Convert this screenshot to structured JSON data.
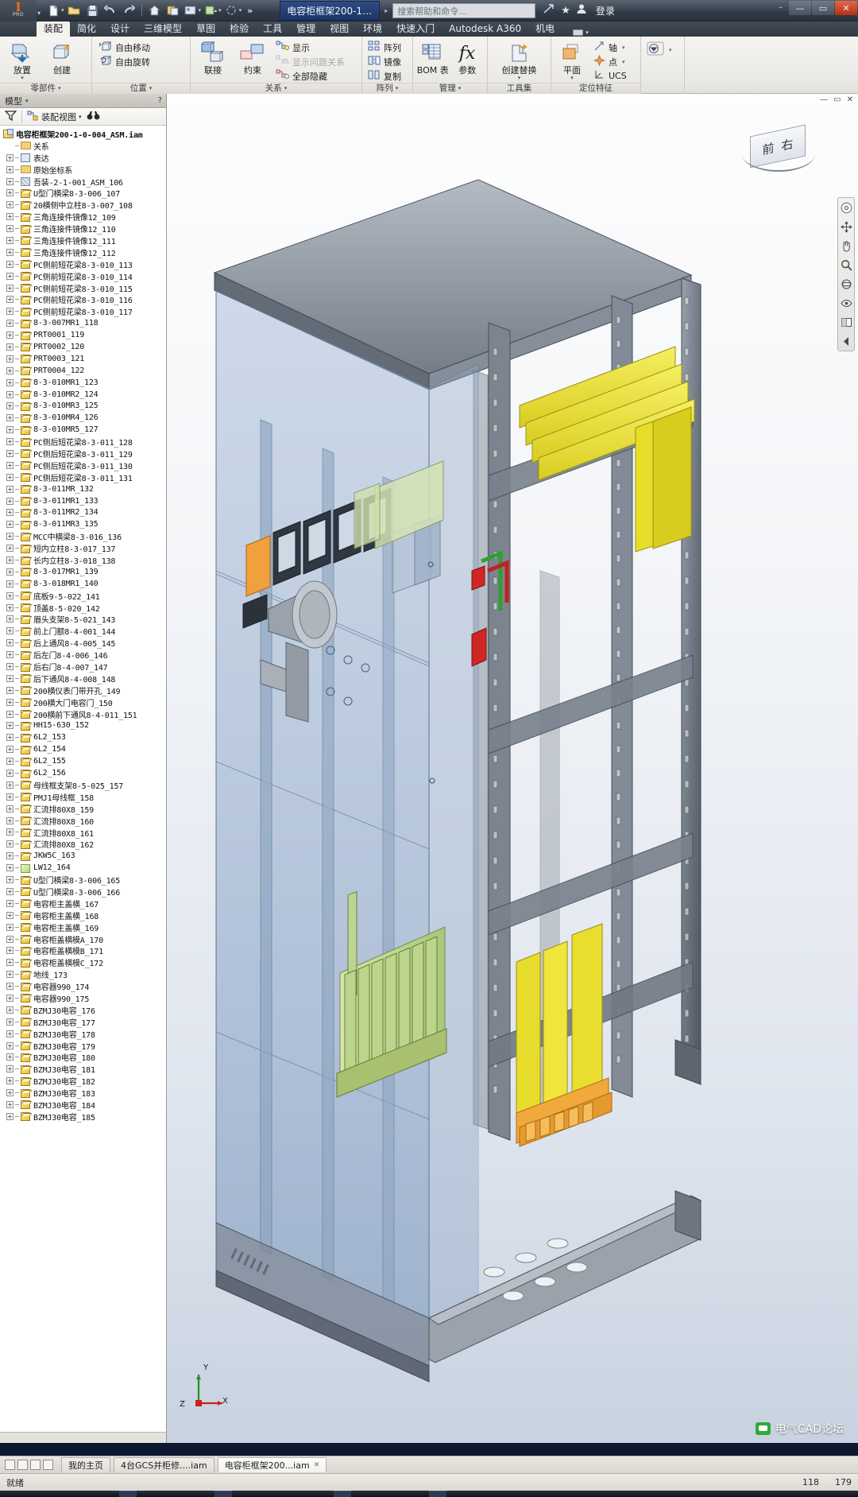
{
  "app": {
    "product": "Autodesk Inventor Professional",
    "logo_mark": "I",
    "logo_sub": "PRO",
    "document_title": "电容柜框架200-1-...",
    "search_placeholder": "搜索帮助和命令...",
    "sign_in": "登录",
    "window_buttons": {
      "minimize": "—",
      "maximize": "▭",
      "close": "✕"
    },
    "quick_access": [
      {
        "name": "new-file-icon",
        "glyph": "📄"
      },
      {
        "name": "open-file-icon",
        "glyph": "📂"
      },
      {
        "name": "save-icon",
        "glyph": "💾"
      },
      {
        "name": "undo-icon",
        "glyph": "↩"
      },
      {
        "name": "redo-icon",
        "glyph": "↪"
      },
      {
        "name": "home-icon",
        "glyph": "⌂"
      },
      {
        "name": "project-icon",
        "glyph": "🗂"
      },
      {
        "name": "appearance-icon",
        "glyph": "🎨"
      },
      {
        "name": "update-icon",
        "glyph": "🔄"
      },
      {
        "name": "select-icon",
        "glyph": "⬚"
      },
      {
        "name": "more-icon",
        "glyph": "»"
      }
    ],
    "title_icons": [
      {
        "name": "share-icon",
        "glyph": "⎋"
      },
      {
        "name": "favorites-icon",
        "glyph": "★"
      },
      {
        "name": "user-icon",
        "glyph": "👤"
      }
    ]
  },
  "ribbon": {
    "tabs": [
      {
        "label": "装配",
        "active": true
      },
      {
        "label": "简化",
        "active": false
      },
      {
        "label": "设计",
        "active": false
      },
      {
        "label": "三维模型",
        "active": false
      },
      {
        "label": "草图",
        "active": false
      },
      {
        "label": "检验",
        "active": false
      },
      {
        "label": "工具",
        "active": false
      },
      {
        "label": "管理",
        "active": false
      },
      {
        "label": "视图",
        "active": false
      },
      {
        "label": "环境",
        "active": false
      },
      {
        "label": "快速入门",
        "active": false
      },
      {
        "label": "Autodesk A360",
        "active": false
      },
      {
        "label": "机电",
        "active": false
      }
    ],
    "panels": [
      {
        "label": "零部件",
        "has_caret": true,
        "big_buttons": [
          {
            "label": "放置",
            "icon": "place-component-icon",
            "dropdown": true
          },
          {
            "label": "创建",
            "icon": "create-component-icon",
            "dropdown": false
          }
        ],
        "small_buttons": []
      },
      {
        "label": "位置",
        "has_caret": true,
        "big_buttons": [],
        "small_buttons": [
          {
            "label": "自由移动",
            "icon": "free-move-icon",
            "disabled": false
          },
          {
            "label": "自由旋转",
            "icon": "free-rotate-icon",
            "disabled": false
          }
        ]
      },
      {
        "label": "关系",
        "has_caret": true,
        "big_buttons": [
          {
            "label": "联接",
            "icon": "joint-icon",
            "dropdown": false
          },
          {
            "label": "约束",
            "icon": "constrain-icon",
            "dropdown": false
          }
        ],
        "small_buttons": [
          {
            "label": "显示",
            "icon": "show-relations-icon",
            "disabled": false
          },
          {
            "label": "显示问题关系",
            "icon": "show-problem-relations-icon",
            "disabled": true
          },
          {
            "label": "全部隐藏",
            "icon": "hide-all-icon",
            "disabled": false
          }
        ]
      },
      {
        "label": "阵列",
        "has_caret": true,
        "big_buttons": [],
        "small_buttons": [
          {
            "label": "阵列",
            "icon": "pattern-icon",
            "disabled": false
          },
          {
            "label": "镜像",
            "icon": "mirror-icon",
            "disabled": false
          },
          {
            "label": "复制",
            "icon": "copy-icon",
            "disabled": false
          }
        ]
      },
      {
        "label": "管理",
        "has_caret": true,
        "big_buttons": [
          {
            "label": "BOM 表",
            "icon": "bom-table-icon",
            "dropdown": false
          },
          {
            "label": "参数",
            "icon": "parameters-icon",
            "dropdown": false
          }
        ],
        "small_buttons": []
      },
      {
        "label": "工具集",
        "has_caret": false,
        "big_buttons": [
          {
            "label": "创建替换",
            "icon": "create-substitute-icon",
            "dropdown": true
          }
        ],
        "small_buttons": []
      },
      {
        "label": "定位特征",
        "has_caret": false,
        "big_buttons": [
          {
            "label": "平面",
            "icon": "work-plane-icon",
            "dropdown": true
          }
        ],
        "small_buttons": [
          {
            "label": "轴",
            "icon": "work-axis-icon",
            "disabled": false,
            "dropdown": true
          },
          {
            "label": "点",
            "icon": "work-point-icon",
            "disabled": false,
            "dropdown": true
          },
          {
            "label": "UCS",
            "icon": "ucs-icon",
            "disabled": false
          }
        ]
      },
      {
        "label": "",
        "has_caret": false,
        "big_buttons": [],
        "small_buttons": [
          {
            "label": "",
            "icon": "appearance-override-icon",
            "disabled": false,
            "dropdown": true
          }
        ]
      }
    ]
  },
  "browser": {
    "panel_title": "模型",
    "close_label": "✕",
    "help_label": "?",
    "toolbar": {
      "filter_icon": "filter-icon",
      "view_icon": "assembly-view-icon",
      "view_label": "装配视图",
      "caret": "▾",
      "find_icon": "binoculars-icon"
    },
    "root": {
      "label": "电容柜框架200-1-0-004_ASM.iam",
      "icon": "assembly-icon"
    },
    "items": [
      {
        "label": "关系",
        "icon": "folder-icon",
        "toggle": "none",
        "indent": 1
      },
      {
        "label": "表达",
        "icon": "representation-icon",
        "toggle": "+",
        "indent": 1
      },
      {
        "label": "原始坐标系",
        "icon": "folder-icon",
        "toggle": "+",
        "indent": 1
      },
      {
        "label": "吾装-2-1-001_ASM_106",
        "icon": "hatch-icon",
        "toggle": "+",
        "indent": 1
      },
      {
        "label": "U型门横梁8-3-006_107",
        "icon": "part-icon",
        "toggle": "+",
        "indent": 1
      },
      {
        "label": "20横侧中立柱8-3-007_108",
        "icon": "part-icon",
        "toggle": "+",
        "indent": 1
      },
      {
        "label": "三角连接件镜像12_109",
        "icon": "part-icon",
        "toggle": "+",
        "indent": 1
      },
      {
        "label": "三角连接件镜像12_110",
        "icon": "part-icon",
        "toggle": "+",
        "indent": 1
      },
      {
        "label": "三角连接件镜像12_111",
        "icon": "part-icon",
        "toggle": "+",
        "indent": 1
      },
      {
        "label": "三角连接件镜像12_112",
        "icon": "part-icon",
        "toggle": "+",
        "indent": 1
      },
      {
        "label": "PC侧前短花梁8-3-010_113",
        "icon": "part-icon",
        "toggle": "+",
        "indent": 1
      },
      {
        "label": "PC侧前短花梁8-3-010_114",
        "icon": "part-icon",
        "toggle": "+",
        "indent": 1
      },
      {
        "label": "PC侧前短花梁8-3-010_115",
        "icon": "part-icon",
        "toggle": "+",
        "indent": 1
      },
      {
        "label": "PC侧前短花梁8-3-010_116",
        "icon": "part-icon",
        "toggle": "+",
        "indent": 1
      },
      {
        "label": "PC侧前短花梁8-3-010_117",
        "icon": "part-icon",
        "toggle": "+",
        "indent": 1
      },
      {
        "label": "8-3-007MR1_118",
        "icon": "part-icon",
        "toggle": "+",
        "indent": 1
      },
      {
        "label": "PRT0001_119",
        "icon": "part-icon",
        "toggle": "+",
        "indent": 1
      },
      {
        "label": "PRT0002_120",
        "icon": "part-icon",
        "toggle": "+",
        "indent": 1
      },
      {
        "label": "PRT0003_121",
        "icon": "part-icon",
        "toggle": "+",
        "indent": 1
      },
      {
        "label": "PRT0004_122",
        "icon": "part-icon",
        "toggle": "+",
        "indent": 1
      },
      {
        "label": "8-3-010MR1_123",
        "icon": "part-icon",
        "toggle": "+",
        "indent": 1
      },
      {
        "label": "8-3-010MR2_124",
        "icon": "part-icon",
        "toggle": "+",
        "indent": 1
      },
      {
        "label": "8-3-010MR3_125",
        "icon": "part-icon",
        "toggle": "+",
        "indent": 1
      },
      {
        "label": "8-3-010MR4_126",
        "icon": "part-icon",
        "toggle": "+",
        "indent": 1
      },
      {
        "label": "8-3-010MR5_127",
        "icon": "part-icon",
        "toggle": "+",
        "indent": 1
      },
      {
        "label": "PC侧后短花梁8-3-011_128",
        "icon": "part-icon",
        "toggle": "+",
        "indent": 1
      },
      {
        "label": "PC侧后短花梁8-3-011_129",
        "icon": "part-icon",
        "toggle": "+",
        "indent": 1
      },
      {
        "label": "PC侧后短花梁8-3-011_130",
        "icon": "part-icon",
        "toggle": "+",
        "indent": 1
      },
      {
        "label": "PC侧后短花梁8-3-011_131",
        "icon": "part-icon",
        "toggle": "+",
        "indent": 1
      },
      {
        "label": "8-3-011MR_132",
        "icon": "part-icon",
        "toggle": "+",
        "indent": 1
      },
      {
        "label": "8-3-011MR1_133",
        "icon": "part-icon",
        "toggle": "+",
        "indent": 1
      },
      {
        "label": "8-3-011MR2_134",
        "icon": "part-icon",
        "toggle": "+",
        "indent": 1
      },
      {
        "label": "8-3-011MR3_135",
        "icon": "part-icon",
        "toggle": "+",
        "indent": 1
      },
      {
        "label": "MCC中横梁8-3-016_136",
        "icon": "part-icon",
        "toggle": "+",
        "indent": 1
      },
      {
        "label": "短内立柱8-3-017_137",
        "icon": "part-icon",
        "toggle": "+",
        "indent": 1
      },
      {
        "label": "长内立柱8-3-018_138",
        "icon": "part-icon",
        "toggle": "+",
        "indent": 1
      },
      {
        "label": "8-3-017MR1_139",
        "icon": "part-icon",
        "toggle": "+",
        "indent": 1
      },
      {
        "label": "8-3-018MR1_140",
        "icon": "part-icon",
        "toggle": "+",
        "indent": 1
      },
      {
        "label": "底板9-5-022_141",
        "icon": "part-icon",
        "toggle": "+",
        "indent": 1
      },
      {
        "label": "顶盖8-5-020_142",
        "icon": "part-icon",
        "toggle": "+",
        "indent": 1
      },
      {
        "label": "眉头支架8-5-021_143",
        "icon": "part-icon",
        "toggle": "+",
        "indent": 1
      },
      {
        "label": "前上门额8-4-001_144",
        "icon": "part-icon",
        "toggle": "+",
        "indent": 1
      },
      {
        "label": "后上通风8-4-005_145",
        "icon": "part-icon",
        "toggle": "+",
        "indent": 1
      },
      {
        "label": "后左门8-4-006_146",
        "icon": "part-icon",
        "toggle": "+",
        "indent": 1
      },
      {
        "label": "后右门8-4-007_147",
        "icon": "part-icon",
        "toggle": "+",
        "indent": 1
      },
      {
        "label": "后下通风8-4-008_148",
        "icon": "part-icon",
        "toggle": "+",
        "indent": 1
      },
      {
        "label": "200横仪表门带开孔_149",
        "icon": "part-icon",
        "toggle": "+",
        "indent": 1
      },
      {
        "label": "200横大门电容门_150",
        "icon": "part-icon",
        "toggle": "+",
        "indent": 1
      },
      {
        "label": "200横前下通风8-4-011_151",
        "icon": "part-icon",
        "toggle": "+",
        "indent": 1
      },
      {
        "label": "HH15-630_152",
        "icon": "part-icon",
        "toggle": "+",
        "indent": 1
      },
      {
        "label": "6L2_153",
        "icon": "part-icon",
        "toggle": "+",
        "indent": 1
      },
      {
        "label": "6L2_154",
        "icon": "part-icon",
        "toggle": "+",
        "indent": 1
      },
      {
        "label": "6L2_155",
        "icon": "part-icon",
        "toggle": "+",
        "indent": 1
      },
      {
        "label": "6L2_156",
        "icon": "part-icon",
        "toggle": "+",
        "indent": 1
      },
      {
        "label": "母线框支架8-5-025_157",
        "icon": "part-icon",
        "toggle": "+",
        "indent": 1
      },
      {
        "label": "PMJ1母线框_158",
        "icon": "part-icon",
        "toggle": "+",
        "indent": 1
      },
      {
        "label": "汇流排80X8_159",
        "icon": "part-icon",
        "toggle": "+",
        "indent": 1
      },
      {
        "label": "汇流排80X8_160",
        "icon": "part-icon",
        "toggle": "+",
        "indent": 1
      },
      {
        "label": "汇流排80X8_161",
        "icon": "part-icon",
        "toggle": "+",
        "indent": 1
      },
      {
        "label": "汇流排80X8_162",
        "icon": "part-icon",
        "toggle": "+",
        "indent": 1
      },
      {
        "label": "JKW5C_163",
        "icon": "part-icon",
        "toggle": "+",
        "indent": 1
      },
      {
        "label": "LW12_164",
        "icon": "green-part-icon",
        "toggle": "+",
        "indent": 1
      },
      {
        "label": "U型门横梁8-3-006_165",
        "icon": "part-icon",
        "toggle": "+",
        "indent": 1
      },
      {
        "label": "U型门横梁8-3-006_166",
        "icon": "part-icon",
        "toggle": "+",
        "indent": 1
      },
      {
        "label": "电容柜主盖横_167",
        "icon": "part-icon",
        "toggle": "+",
        "indent": 1
      },
      {
        "label": "电容柜主盖横_168",
        "icon": "part-icon",
        "toggle": "+",
        "indent": 1
      },
      {
        "label": "电容柜主盖横_169",
        "icon": "part-icon",
        "toggle": "+",
        "indent": 1
      },
      {
        "label": "电容柜盖横模A_170",
        "icon": "part-icon",
        "toggle": "+",
        "indent": 1
      },
      {
        "label": "电容柜盖横模B_171",
        "icon": "part-icon",
        "toggle": "+",
        "indent": 1
      },
      {
        "label": "电容柜盖横模C_172",
        "icon": "part-icon",
        "toggle": "+",
        "indent": 1
      },
      {
        "label": "地线_173",
        "icon": "part-icon",
        "toggle": "+",
        "indent": 1
      },
      {
        "label": "电容器990_174",
        "icon": "part-icon",
        "toggle": "+",
        "indent": 1
      },
      {
        "label": "电容器990_175",
        "icon": "part-icon",
        "toggle": "+",
        "indent": 1
      },
      {
        "label": "BZMJ30电容_176",
        "icon": "part-icon",
        "toggle": "+",
        "indent": 1
      },
      {
        "label": "BZMJ30电容_177",
        "icon": "part-icon",
        "toggle": "+",
        "indent": 1
      },
      {
        "label": "BZMJ30电容_178",
        "icon": "part-icon",
        "toggle": "+",
        "indent": 1
      },
      {
        "label": "BZMJ30电容_179",
        "icon": "part-icon",
        "toggle": "+",
        "indent": 1
      },
      {
        "label": "BZMJ30电容_180",
        "icon": "part-icon",
        "toggle": "+",
        "indent": 1
      },
      {
        "label": "BZMJ30电容_181",
        "icon": "part-icon",
        "toggle": "+",
        "indent": 1
      },
      {
        "label": "BZMJ30电容_182",
        "icon": "part-icon",
        "toggle": "+",
        "indent": 1
      },
      {
        "label": "BZMJ30电容_183",
        "icon": "part-icon",
        "toggle": "+",
        "indent": 1
      },
      {
        "label": "BZMJ30电容_184",
        "icon": "part-icon",
        "toggle": "+",
        "indent": 1
      },
      {
        "label": "BZMJ30电容_185",
        "icon": "part-icon",
        "toggle": "+",
        "indent": 1
      }
    ]
  },
  "viewport": {
    "view_cube": {
      "face_left": "前",
      "face_right": "右"
    },
    "axis_triad": {
      "x": "X",
      "y": "Y",
      "z": "Z"
    },
    "nav_tools": [
      {
        "name": "steering-wheel-icon",
        "glyph": "◎"
      },
      {
        "name": "pan-icon",
        "glyph": "✥"
      },
      {
        "name": "zoom-icon",
        "glyph": "🔍"
      },
      {
        "name": "orbit-icon",
        "glyph": "↻"
      },
      {
        "name": "look-at-icon",
        "glyph": "⌖"
      },
      {
        "name": "display-mode-icon",
        "glyph": "◧"
      },
      {
        "name": "previous-view-icon",
        "glyph": "◁"
      }
    ],
    "window_controls": [
      {
        "name": "viewport-minimize-icon",
        "glyph": "—"
      },
      {
        "name": "viewport-restore-icon",
        "glyph": "▭"
      },
      {
        "name": "viewport-close-icon",
        "glyph": "✕"
      }
    ],
    "watermark": "电气CAD论坛"
  },
  "doc_tabs": {
    "dock_buttons": [
      "dock-left-icon",
      "dock-grid-icon",
      "dock-split-icon",
      "dock-right-icon"
    ],
    "tabs": [
      {
        "label": "我的主页",
        "active": false,
        "closable": false
      },
      {
        "label": "4台GCS并柜修....iam",
        "active": false,
        "closable": false
      },
      {
        "label": "电容柜框架200...iam",
        "active": true,
        "closable": true
      }
    ],
    "close_glyph": "✕"
  },
  "status_bar": {
    "message": "就绪",
    "value_1": "118",
    "value_2": "179"
  }
}
